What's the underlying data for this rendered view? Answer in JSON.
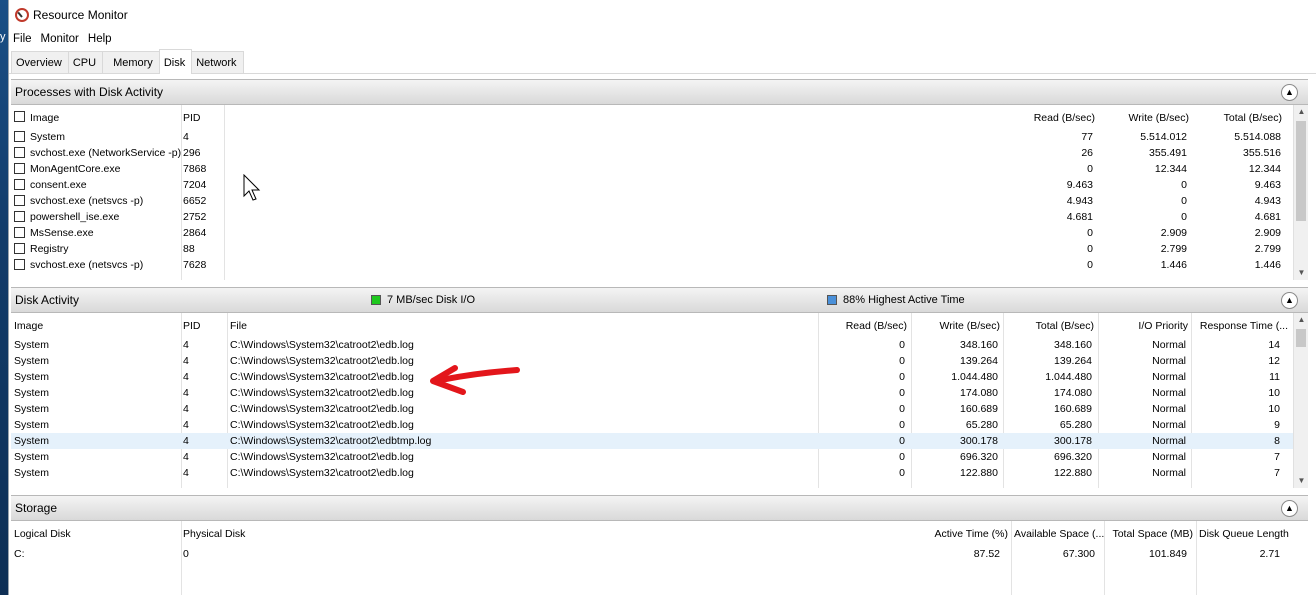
{
  "desktop": {
    "edge_glyph": "y"
  },
  "window": {
    "title": "Resource Monitor"
  },
  "menu": [
    "File",
    "Monitor",
    "Help"
  ],
  "tabs": [
    {
      "label": "Overview"
    },
    {
      "label": "CPU"
    },
    {
      "label": "Memory"
    },
    {
      "label": "Disk"
    },
    {
      "label": "Network"
    }
  ],
  "processes": {
    "title": "Processes with Disk Activity",
    "columns": {
      "image": "Image",
      "pid": "PID",
      "read": "Read (B/sec)",
      "write": "Write (B/sec)",
      "total": "Total (B/sec)"
    },
    "rows": [
      {
        "image": "System",
        "pid": "4",
        "read": "77",
        "write": "5.514.012",
        "total": "5.514.088"
      },
      {
        "image": "svchost.exe (NetworkService -p)",
        "pid": "296",
        "read": "26",
        "write": "355.491",
        "total": "355.516"
      },
      {
        "image": "MonAgentCore.exe",
        "pid": "7868",
        "read": "0",
        "write": "12.344",
        "total": "12.344"
      },
      {
        "image": "consent.exe",
        "pid": "7204",
        "read": "9.463",
        "write": "0",
        "total": "9.463"
      },
      {
        "image": "svchost.exe (netsvcs -p)",
        "pid": "6652",
        "read": "4.943",
        "write": "0",
        "total": "4.943"
      },
      {
        "image": "powershell_ise.exe",
        "pid": "2752",
        "read": "4.681",
        "write": "0",
        "total": "4.681"
      },
      {
        "image": "MsSense.exe",
        "pid": "2864",
        "read": "0",
        "write": "2.909",
        "total": "2.909"
      },
      {
        "image": "Registry",
        "pid": "88",
        "read": "0",
        "write": "2.799",
        "total": "2.799"
      },
      {
        "image": "svchost.exe (netsvcs -p)",
        "pid": "7628",
        "read": "0",
        "write": "1.446",
        "total": "1.446"
      }
    ]
  },
  "disk_activity": {
    "title": "Disk Activity",
    "io_legend": "7 MB/sec Disk I/O",
    "active_legend": "88% Highest Active Time",
    "io_color": "#1ec81e",
    "active_color": "#4a90d9",
    "columns": {
      "image": "Image",
      "pid": "PID",
      "file": "File",
      "read": "Read (B/sec)",
      "write": "Write (B/sec)",
      "total": "Total (B/sec)",
      "priority": "I/O Priority",
      "response": "Response Time (..."
    },
    "rows": [
      {
        "image": "System",
        "pid": "4",
        "file": "C:\\Windows\\System32\\catroot2\\edb.log",
        "read": "0",
        "write": "348.160",
        "total": "348.160",
        "priority": "Normal",
        "response": "14"
      },
      {
        "image": "System",
        "pid": "4",
        "file": "C:\\Windows\\System32\\catroot2\\edb.log",
        "read": "0",
        "write": "139.264",
        "total": "139.264",
        "priority": "Normal",
        "response": "12"
      },
      {
        "image": "System",
        "pid": "4",
        "file": "C:\\Windows\\System32\\catroot2\\edb.log",
        "read": "0",
        "write": "1.044.480",
        "total": "1.044.480",
        "priority": "Normal",
        "response": "11"
      },
      {
        "image": "System",
        "pid": "4",
        "file": "C:\\Windows\\System32\\catroot2\\edb.log",
        "read": "0",
        "write": "174.080",
        "total": "174.080",
        "priority": "Normal",
        "response": "10"
      },
      {
        "image": "System",
        "pid": "4",
        "file": "C:\\Windows\\System32\\catroot2\\edb.log",
        "read": "0",
        "write": "160.689",
        "total": "160.689",
        "priority": "Normal",
        "response": "10"
      },
      {
        "image": "System",
        "pid": "4",
        "file": "C:\\Windows\\System32\\catroot2\\edb.log",
        "read": "0",
        "write": "65.280",
        "total": "65.280",
        "priority": "Normal",
        "response": "9"
      },
      {
        "image": "System",
        "pid": "4",
        "file": "C:\\Windows\\System32\\catroot2\\edbtmp.log",
        "read": "0",
        "write": "300.178",
        "total": "300.178",
        "priority": "Normal",
        "response": "8"
      },
      {
        "image": "System",
        "pid": "4",
        "file": "C:\\Windows\\System32\\catroot2\\edb.log",
        "read": "0",
        "write": "696.320",
        "total": "696.320",
        "priority": "Normal",
        "response": "7"
      },
      {
        "image": "System",
        "pid": "4",
        "file": "C:\\Windows\\System32\\catroot2\\edb.log",
        "read": "0",
        "write": "122.880",
        "total": "122.880",
        "priority": "Normal",
        "response": "7"
      }
    ]
  },
  "storage": {
    "title": "Storage",
    "columns": {
      "logical": "Logical Disk",
      "physical": "Physical Disk",
      "active": "Active Time (%)",
      "available": "Available Space (...",
      "total": "Total Space (MB)",
      "queue": "Disk Queue Length"
    },
    "rows": [
      {
        "logical": "C:",
        "physical": "0",
        "active": "87.52",
        "available": "67.300",
        "total": "101.849",
        "queue": "2.71"
      }
    ]
  }
}
